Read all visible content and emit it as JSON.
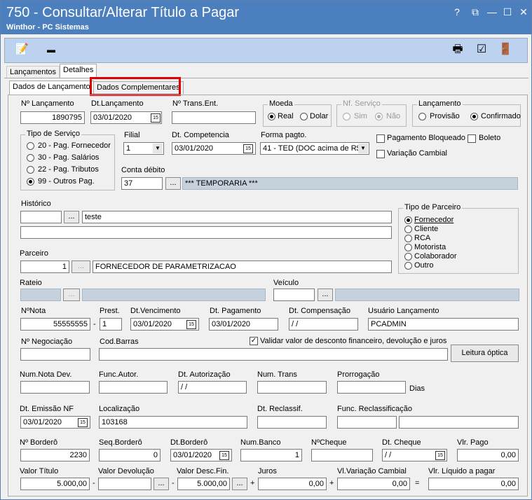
{
  "window": {
    "title": "750 - Consultar/Alterar Título a Pagar",
    "subtitle": "Winthor - PC Sistemas",
    "controls": [
      "?",
      "⧉",
      "—",
      "☐",
      "✕"
    ]
  },
  "tabs_main": [
    "Lançamentos",
    "Detalhes"
  ],
  "tabs_sub": [
    "Dados de Lançamento",
    "Dados Complementares"
  ],
  "highlight_color": "#e00000",
  "f": {
    "n_lancamento_label": "Nº Lançamento",
    "n_lancamento": "1890795",
    "dt_lancamento_label": "Dt.Lançamento",
    "dt_lancamento": "03/01/2020",
    "n_trans_ent_label": "Nº Trans.Ent.",
    "n_trans_ent": "",
    "moeda_label": "Moeda",
    "moeda_opts": [
      "Real",
      "Dolar"
    ],
    "nf_servico_label": "Nf. Serviço",
    "nf_servico_opts": [
      "Sim",
      "Não"
    ],
    "lancamento_label": "Lançamento",
    "lancamento_opts": [
      "Provisão",
      "Confirmado"
    ],
    "tipo_servico_label": "Tipo de Serviço",
    "tipo_servico_opts": [
      "20 - Pag. Fornecedor",
      "30 - Pag. Salários",
      "22 - Pag. Tributos",
      "99 - Outros Pag."
    ],
    "filial_label": "Filial",
    "filial": "1",
    "dt_competencia_label": "Dt. Competencia",
    "dt_competencia": "03/01/2020",
    "forma_pagto_label": "Forma pagto.",
    "forma_pagto": "41 - TED (DOC acima de R$",
    "pagamento_bloqueado": "Pagamento Bloqueado",
    "boleto": "Boleto",
    "variacao_cambial": "Variação Cambial",
    "conta_debito_label": "Conta débito",
    "conta_debito": "37",
    "conta_debito_desc": "*** TEMPORARIA ***",
    "historico_label": "Histórico",
    "historico": "teste",
    "tipo_parceiro_label": "Tipo de Parceiro",
    "tipo_parceiro_opts": [
      "Fornecedor",
      "Cliente",
      "RCA",
      "Motorista",
      "Colaborador",
      "Outro"
    ],
    "parceiro_label": "Parceiro",
    "parceiro_cod": "1",
    "parceiro_nome": "FORNECEDOR DE PARAMETRIZACAO",
    "rateio_label": "Rateio",
    "veiculo_label": "Veículo",
    "n_nota_label": "NºNota",
    "n_nota": "55555555",
    "prest_label": "Prest.",
    "prest": "1",
    "dt_vencimento_label": "Dt.Vencimento",
    "dt_vencimento": "03/01/2020",
    "dt_pagamento_label": "Dt. Pagamento",
    "dt_pagamento": "03/01/2020",
    "dt_compensacao_label": "Dt. Compensação",
    "dt_compensacao": " / /",
    "usuario_label": "Usuário Lançamento",
    "usuario": "PCADMIN",
    "n_negociacao_label": "Nº Negociação",
    "cod_barras_label": "Cod.Barras",
    "validar_label": "Validar valor de desconto financeiro,  devolução e juros",
    "leitura_optica": "Leitura óptica",
    "num_nota_dev_label": "Num.Nota Dev.",
    "func_autor_label": "Func.Autor.",
    "dt_autorizacao_label": "Dt. Autorização",
    "dt_autorizacao": " / /",
    "num_trans_label": "Num. Trans",
    "prorrogacao_label": "Prorrogação",
    "dias": "Dias",
    "dt_emissao_nf_label": "Dt. Emissão NF",
    "dt_emissao_nf": "03/01/2020",
    "localizacao_label": "Localização",
    "localizacao": "103168",
    "dt_reclassif_label": "Dt. Reclassif.",
    "func_reclass_label": "Func. Reclassificação",
    "n_bordero_label": "Nº Borderô",
    "n_bordero": "2230",
    "seq_bordero_label": "Seq.Borderô",
    "seq_bordero": "0",
    "dt_bordero_label": "Dt.Borderô",
    "dt_bordero": "03/01/2020",
    "num_banco_label": "Num.Banco",
    "num_banco": "1",
    "n_cheque_label": "NºCheque",
    "dt_cheque_label": "Dt. Cheque",
    "dt_cheque": " / /",
    "vlr_pago_label": "Vlr. Pago",
    "vlr_pago": "0,00",
    "valor_titulo_label": "Valor Título",
    "valor_titulo": "5.000,00",
    "valor_devolucao_label": "Valor Devolução",
    "valor_desc_fin_label": "Valor Desc.Fin.",
    "valor_desc_fin": "5.000,00",
    "juros_label": "Juros",
    "juros": "0,00",
    "vl_variacao_label": "Vl.Variação Cambial",
    "vl_variacao": "0,00",
    "vlr_liquido_label": "Vlr. Líquido a pagar",
    "vlr_liquido": "0,00",
    "ellipsis": "...",
    "minus": "-",
    "plus": "+",
    "equals": "="
  }
}
